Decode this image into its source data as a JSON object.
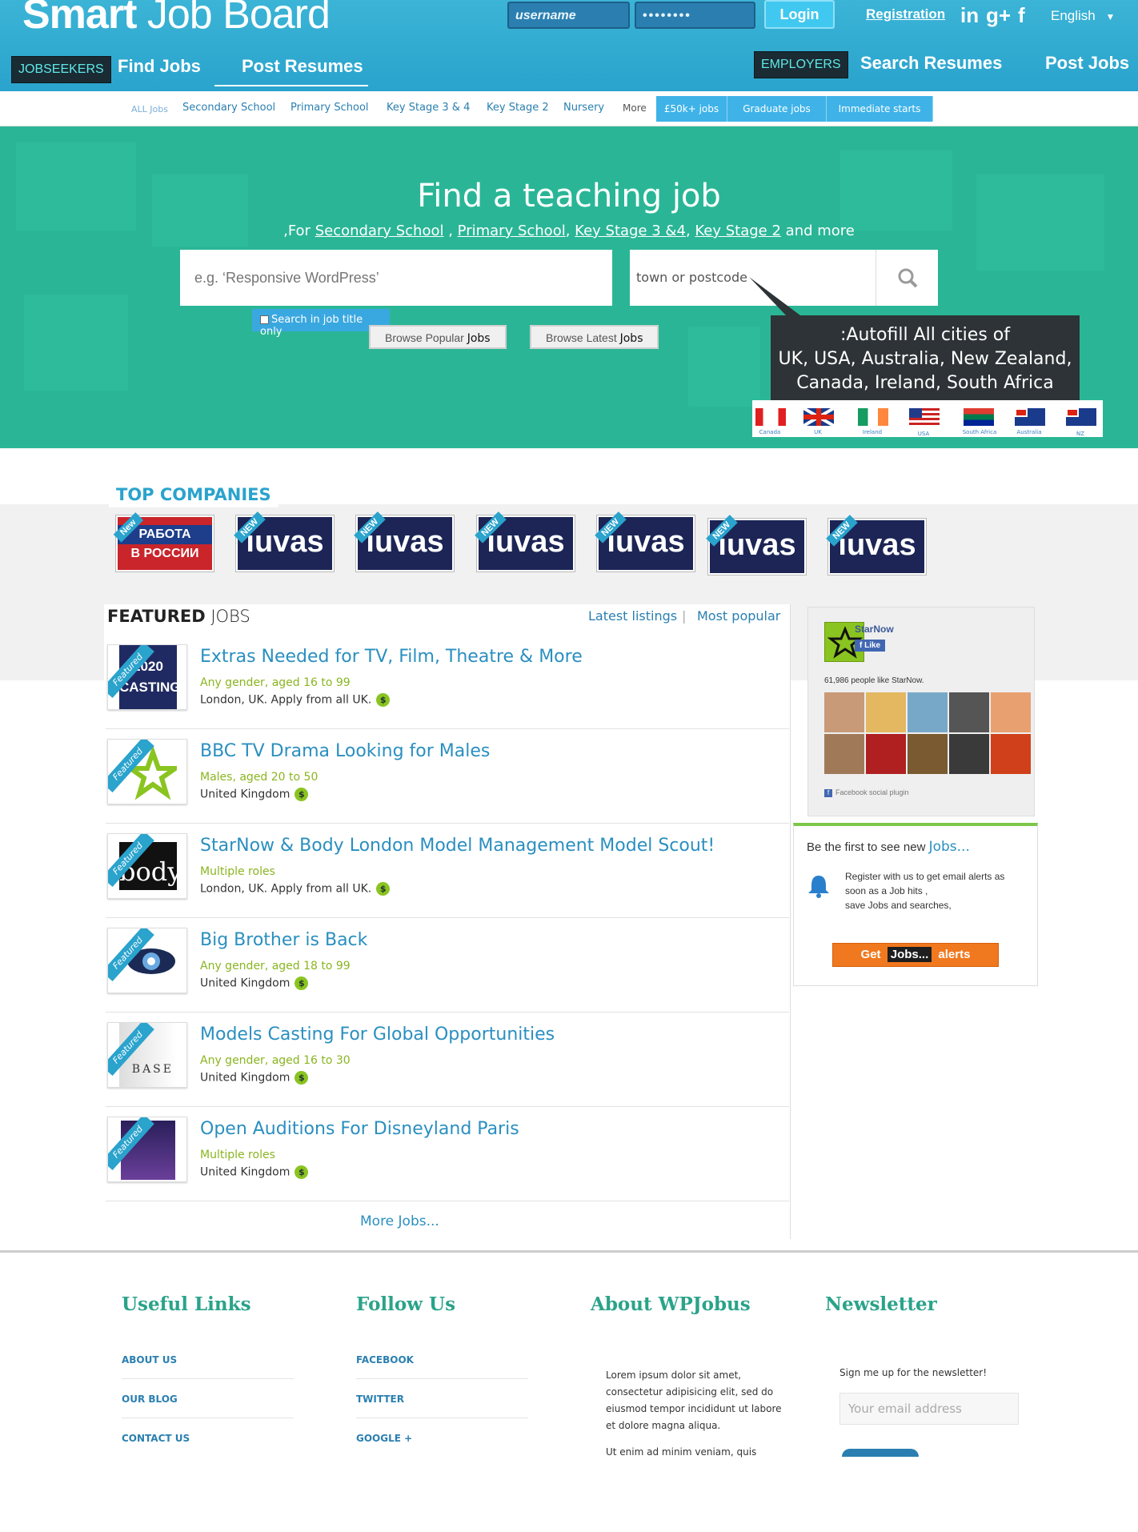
{
  "header": {
    "logo_part1": "Smart",
    "logo_part2": "Job Board",
    "username_placeholder": "username",
    "password_value": "••••••••",
    "login_label": "Login",
    "registration_label": "Registration",
    "social_icons": [
      "linkedin-icon",
      "google-plus-icon",
      "facebook-icon"
    ],
    "social_text": [
      "in",
      "g+",
      "f"
    ],
    "language": "English",
    "language_caret": "▼",
    "jobseekers_label": "JOBSEEKERS",
    "find_jobs": "Find Jobs",
    "post_resumes": "Post Resumes",
    "employers_label": "EMPLOYERS",
    "search_resumes": "Search Resumes",
    "post_jobs": "Post Jobs"
  },
  "categories": {
    "all_jobs": "ALL Jobs",
    "items": [
      "Secondary School",
      "Primary School",
      "Key Stage 3 & 4",
      "Key Stage 2",
      "Nursery",
      "More"
    ],
    "highlighted": [
      "£50k+ jobs",
      "Graduate jobs",
      "Immediate starts"
    ]
  },
  "hero": {
    "title": "Find a teaching job",
    "sub_prefix": ",For",
    "sub_links": [
      "Secondary School",
      "Primary School",
      "Key Stage 3 &4",
      "Key Stage 2"
    ],
    "sub_suffix": "and more",
    "keyword_placeholder": "e.g. ‘Responsive WordPress’",
    "location_placeholder": "town or postcode",
    "title_only_label": "Search in job title only",
    "browse_popular_prefix": "Browse Popular",
    "browse_latest_prefix": "Browse Latest",
    "jobs_word": "Jobs",
    "tooltip_line1": ":Autofill All cities of",
    "tooltip_line2": "UK, USA, Australia, New Zealand,",
    "tooltip_line3": "Canada, Ireland, South Africa",
    "flags": [
      "Canada",
      "UK",
      "Ireland",
      "USA",
      "South Africa",
      "Australia",
      "NZ"
    ]
  },
  "companies": {
    "title": "TOP COMPANIES",
    "first_logo_line1": "РАБОТА",
    "first_logo_line2": "В РОССИИ",
    "first_logo_tag": "New",
    "logo_text": "iuvas",
    "new_tag": "NEW"
  },
  "featured": {
    "title_bold": "FEATURED",
    "title_rest": "JOBS",
    "tab_latest": "Latest listings",
    "tab_popular": "Most popular",
    "ribbon": "Featured",
    "currency_symbol": "$",
    "jobs": [
      {
        "title": "Extras Needed for TV, Film, Theatre & More",
        "sub": "Any gender, aged 16 to 99",
        "loc": "London, UK. Apply from all UK.",
        "thumb": "2020 CASTING"
      },
      {
        "title": "BBC TV Drama Looking for Males",
        "sub": "Males, aged 20 to 50",
        "loc": "United Kingdom",
        "thumb": ""
      },
      {
        "title": "StarNow & Body London Model Management Model Scout!",
        "sub": "Multiple roles",
        "loc": "London, UK. Apply from all UK.",
        "thumb": "body"
      },
      {
        "title": "Big Brother is Back",
        "sub": "Any gender, aged 18 to 99",
        "loc": "United Kingdom",
        "thumb": ""
      },
      {
        "title": "Models Casting For Global Opportunities",
        "sub": "Any gender, aged 16 to 30",
        "loc": "United Kingdom",
        "thumb": "BASE"
      },
      {
        "title": "Open Auditions For Disneyland Paris",
        "sub": "Multiple roles",
        "loc": "United Kingdom",
        "thumb": ""
      }
    ],
    "more_jobs": "More Jobs..."
  },
  "sidebar": {
    "fb_page": "StarNow",
    "fb_like": "Like",
    "fb_count": "61,986 people like StarNow.",
    "fb_plugin": "Facebook social plugin",
    "alert_title_prefix": "Be the first to see new",
    "alert_title_link": "Jobs...",
    "alert_text_1": "Register with us to get email alerts as",
    "alert_text_2": "soon as a Job hits ,",
    "alert_text_3": "save Jobs and searches,",
    "get_prefix": "Get",
    "get_jobs": "Jobs...",
    "get_suffix": "alerts"
  },
  "footer": {
    "useful_title": "Useful Links",
    "useful_links": [
      "ABOUT US",
      "OUR BLOG",
      "CONTACT US"
    ],
    "follow_title": "Follow Us",
    "follow_links": [
      "FACEBOOK",
      "TWITTER",
      "GOOGLE +"
    ],
    "about_title": "About WPJobus",
    "about_p1": "Lorem ipsum dolor sit amet, consectetur adipisicing elit, sed do eiusmod tempor incididunt ut labore et dolore magna aliqua.",
    "about_p2": "Ut enim ad minim veniam, quis",
    "newsletter_title": "Newsletter",
    "newsletter_label": "Sign me up for the newsletter!",
    "newsletter_placeholder": "Your email address"
  },
  "colors": {
    "header": "#2aa3cd",
    "hero": "#2ab696",
    "link": "#2a8fc0",
    "green": "#8ab520",
    "orange": "#f0781e"
  }
}
